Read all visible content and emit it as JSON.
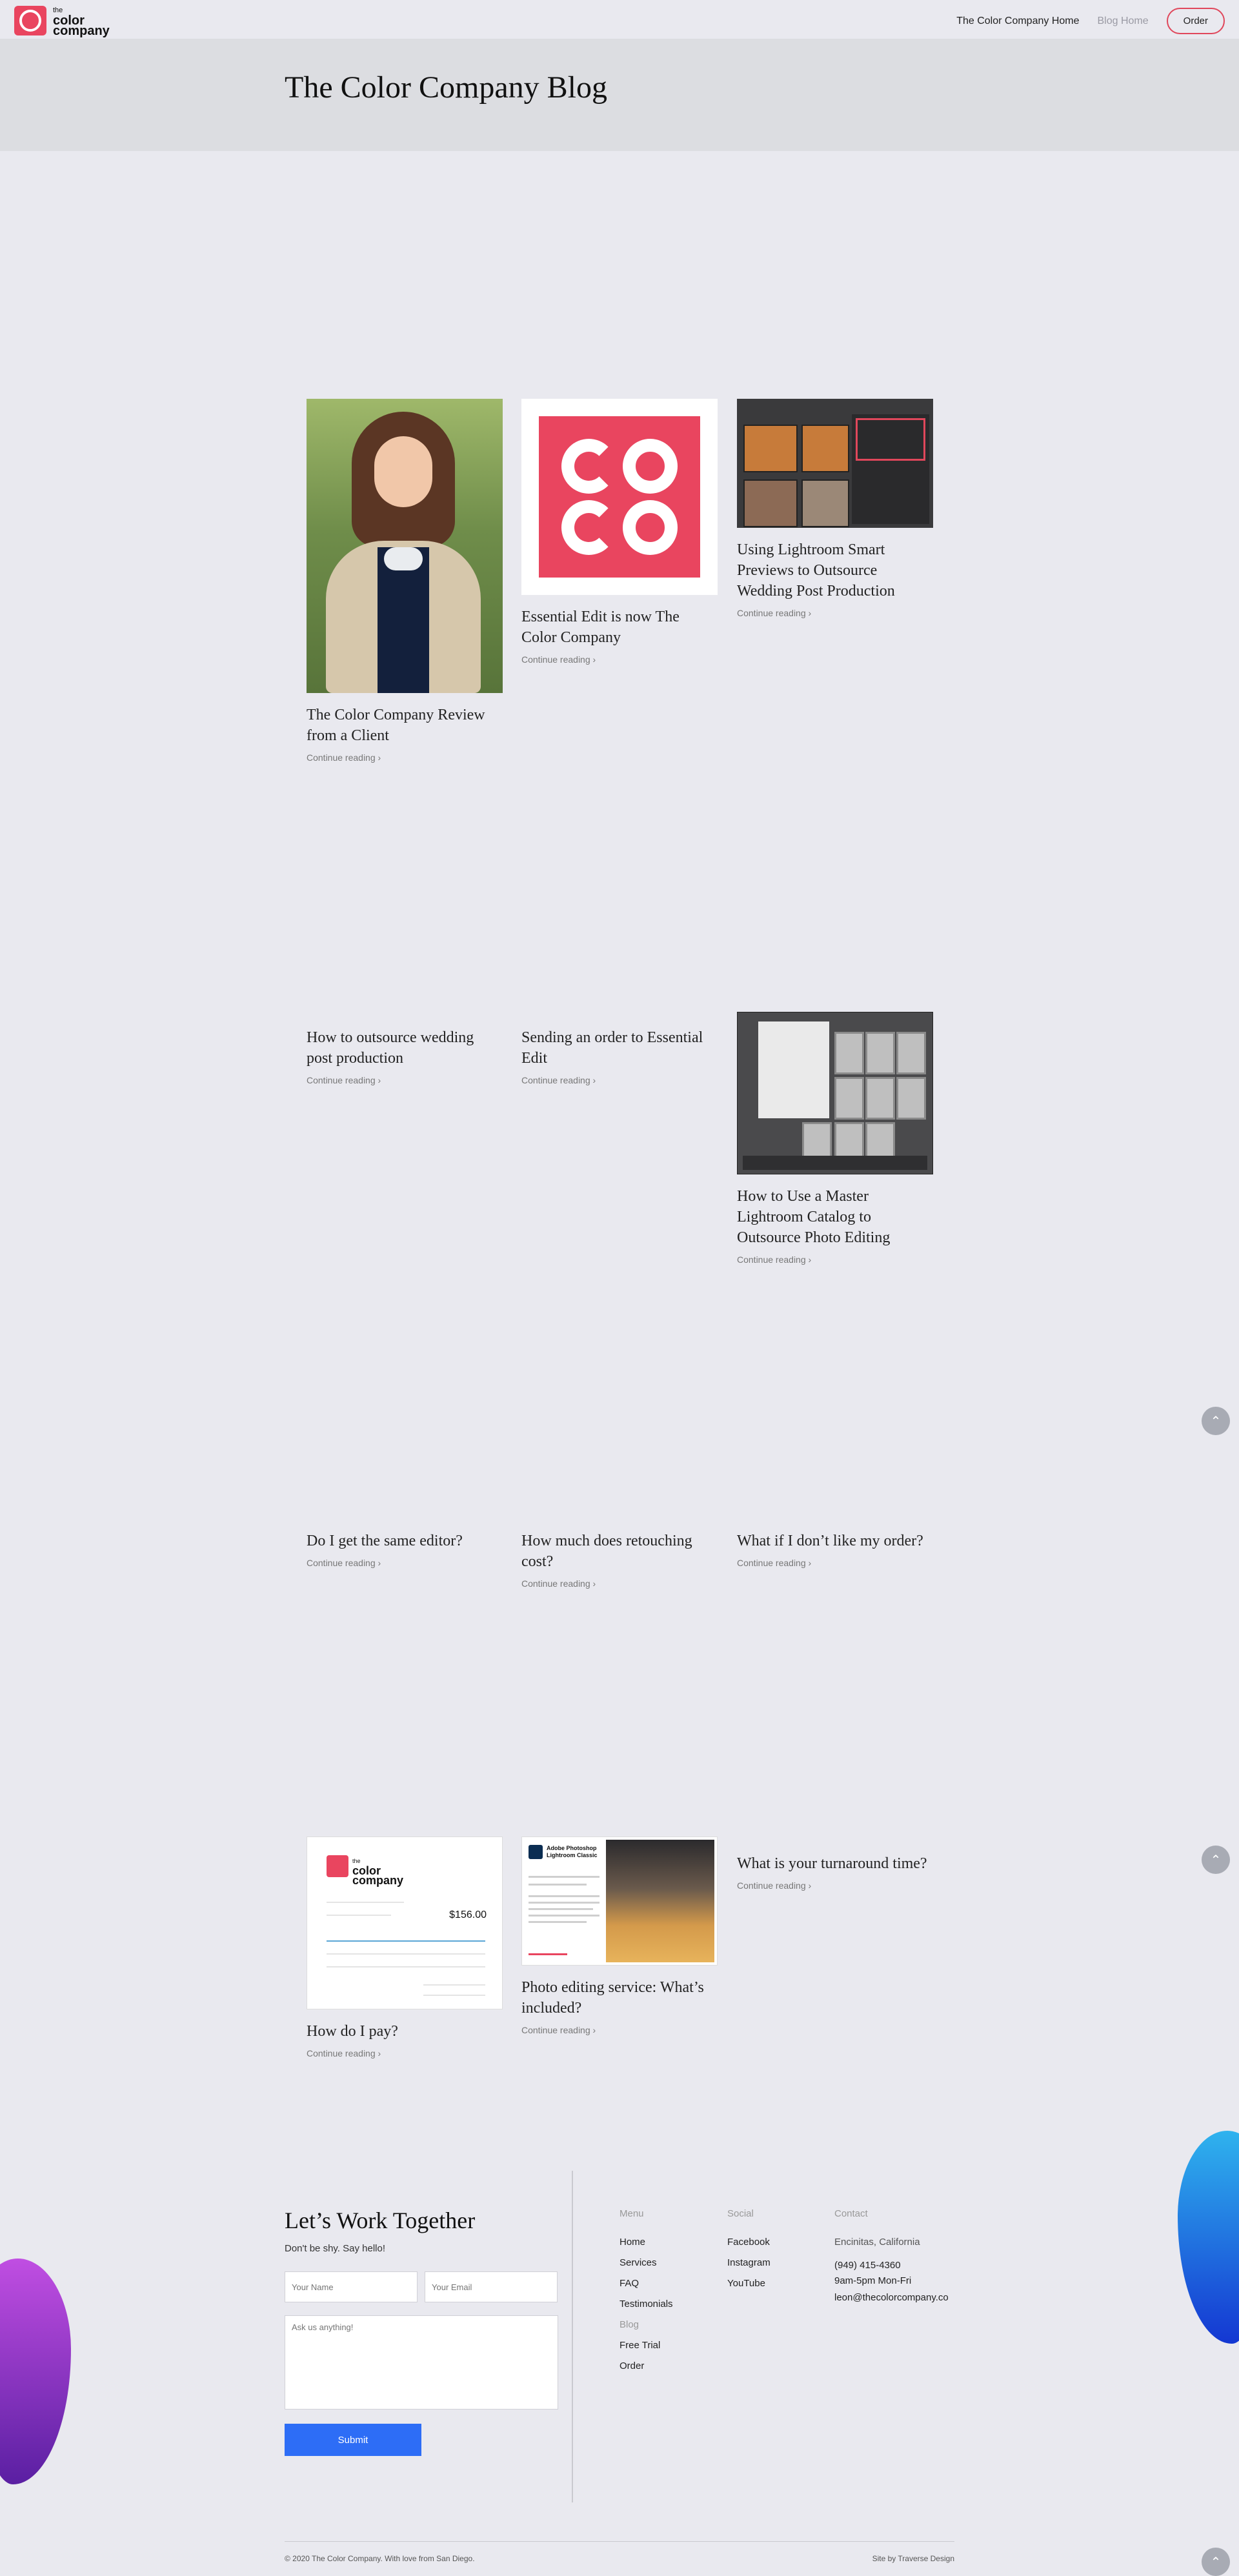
{
  "brand": {
    "logo_text_line1": "the",
    "logo_text_line2": "color",
    "logo_text_line3": "company",
    "accent": "#e0475b",
    "brand_red": "#e9455f",
    "blue": "#2d6df6"
  },
  "nav": {
    "home": "The Color Company Home",
    "blog": "Blog Home",
    "order": "Order"
  },
  "banner": {
    "title": "The Color Company Blog"
  },
  "posts": [
    {
      "title": "The Color Company Review from a Client",
      "more": "Continue reading ›"
    },
    {
      "title": "Essential Edit is now The Color Company",
      "more": "Continue reading ›"
    },
    {
      "title": "Using Lightroom Smart Previews to Outsource Wedding Post Production",
      "more": "Continue reading ›"
    },
    {
      "title": "How to outsource wedding post production",
      "more": "Continue reading ›"
    },
    {
      "title": "Sending an order to Essential Edit",
      "more": "Continue reading ›"
    },
    {
      "title": "How to Use a Master Lightroom Catalog to Outsource Photo Editing",
      "more": "Continue reading ›"
    },
    {
      "title": "Do I get the same editor?",
      "more": "Continue reading ›"
    },
    {
      "title": "How much does retouching cost?",
      "more": "Continue reading ›"
    },
    {
      "title": "What if I don’t like my order?",
      "more": "Continue reading ›"
    },
    {
      "title": "How do I pay?",
      "more": "Continue reading ›"
    },
    {
      "title": "Photo editing service: What’s included?",
      "more": "Continue reading ›"
    },
    {
      "title": "What is your turnaround time?",
      "more": "Continue reading ›"
    }
  ],
  "images": {
    "invoice_total": "$156.00",
    "ad_title": "Adobe Photoshop Lightroom Classic"
  },
  "footer": {
    "heading": "Let’s Work Together",
    "sub": "Don't be shy. Say hello!",
    "name_placeholder": "Your Name",
    "email_placeholder": "Your Email",
    "message_placeholder": "Ask us anything!",
    "submit": "Submit",
    "menu_head": "Menu",
    "menu": [
      "Home",
      "Services",
      "FAQ",
      "Testimonials",
      "Blog",
      "Free Trial",
      "Order"
    ],
    "social_head": "Social",
    "social": [
      "Facebook",
      "Instagram",
      "YouTube"
    ],
    "contact_head": "Contact",
    "contact": [
      "Encinitas, California",
      "(949) 415-4360",
      "9am-5pm Mon-Fri",
      "leon@thecolorcompany.co"
    ],
    "copyright": "© 2020 The Color Company. With love from San Diego.",
    "credit": "Site by Traverse Design"
  }
}
